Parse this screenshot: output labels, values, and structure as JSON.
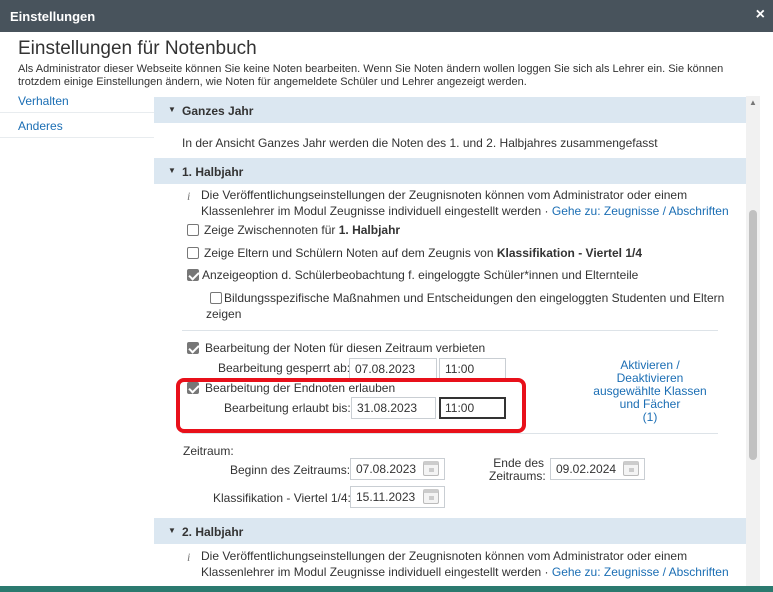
{
  "window": {
    "title": "Einstellungen",
    "close": "×"
  },
  "header": {
    "title": "Einstellungen für Notenbuch",
    "description_line1": "Als Administrator dieser Webseite können Sie keine Noten bearbeiten. Wenn Sie Noten ändern wollen loggen Sie sich als Lehrer ein. Sie können",
    "description_line2": "trotzdem einige Einstellungen ändern, wie Noten für angemeldete Schüler und Lehrer angezeigt werden."
  },
  "sidebar": {
    "items": [
      {
        "label": "Verhalten"
      },
      {
        "label": "Anderes"
      }
    ]
  },
  "sections": {
    "ganzes_jahr": {
      "label": "Ganzes Jahr",
      "text": "In der Ansicht Ganzes Jahr werden die Noten des 1. und 2. Halbjahres zusammengefasst"
    },
    "halbjahr1": {
      "label": "1. Halbjahr",
      "info_line1": "Die Veröffentlichungseinstellungen der Zeugnisnoten können vom Administrator oder einem",
      "info_line2": "Klassenlehrer im Modul Zeugnisse individuell eingestellt werden",
      "info_sep": " · ",
      "info_link": "Gehe zu: Zeugnisse / Abschriften",
      "opt1_text": "Zeige Zwischennoten für ",
      "opt1_bold": "1. Halbjahr",
      "opt1_checked": false,
      "opt2_text": "Zeige Eltern und Schülern Noten auf dem Zeugnis von ",
      "opt2_bold": "Klassifikation - Viertel 1/4",
      "opt2_checked": false,
      "opt3_text": "Anzeigeoption d. Schülerbeobachtung f. eingeloggte Schüler*innen und Elternteile",
      "opt3_checked": true,
      "opt4_line1": "Bildungsspezifische Maßnahmen und Entscheidungen den eingeloggten Studenten und Eltern",
      "opt4_line2": "zeigen",
      "opt4_checked": false,
      "lock_label": "Bearbeitung der Noten für diesen Zeitraum verbieten",
      "lock_checked": true,
      "locked_on_label": "Bearbeitung gesperrt ab:",
      "locked_on_date": "07.08.2023",
      "locked_on_time": "11:00",
      "final_label": "Bearbeitung der Endnoten erlauben",
      "final_checked": true,
      "allowed_until_label": "Bearbeitung erlaubt bis:",
      "allowed_until_date": "31.08.2023",
      "allowed_until_time": "11:00",
      "toggle_link_line1": "Aktivieren /",
      "toggle_link_line2": "Deaktivieren",
      "toggle_link_line3": "ausgewählte Klassen",
      "toggle_link_line4": "und Fächer",
      "toggle_link_line5": "(1)",
      "period_label": "Zeitraum:",
      "start_label": "Beginn des Zeitraums:",
      "start_date": "07.08.2023",
      "end_label_line1": "Ende des",
      "end_label_line2": "Zeitraums:",
      "end_date": "09.02.2024",
      "class_label": "Klassifikation - Viertel 1/4:",
      "class_date": "15.11.2023"
    },
    "halbjahr2": {
      "label": "2. Halbjahr",
      "info_line1": "Die Veröffentlichungseinstellungen der Zeugnisnoten können vom Administrator oder einem",
      "info_line2": "Klassenlehrer im Modul Zeugnisse individuell eingestellt werden",
      "info_sep": " · ",
      "info_link": "Gehe zu: Zeugnisse / Abschriften"
    }
  },
  "colors": {
    "titlebar": "#48535c",
    "section_header": "#dbe7f1",
    "link": "#1b6eb4",
    "highlight": "#e8101a"
  },
  "icons": {
    "collapse": "caret-down-icon",
    "info": "info-icon",
    "calendar": "calendar-icon",
    "close": "close-icon"
  }
}
